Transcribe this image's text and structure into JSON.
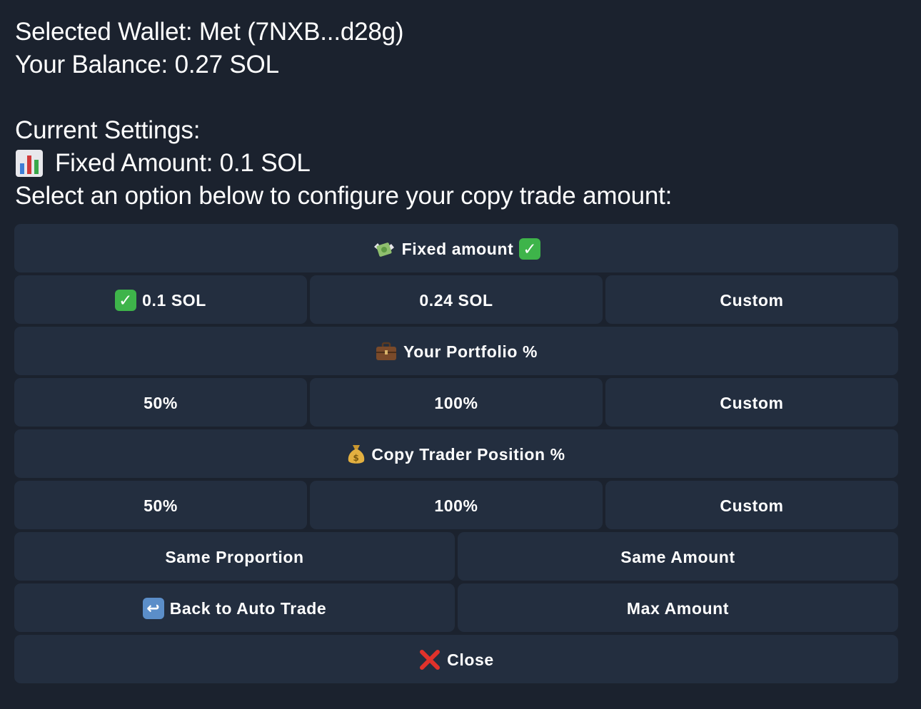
{
  "message": {
    "wallet_line": "Selected Wallet: Met (7NXB...d28g)",
    "balance_line": "Your Balance: 0.27 SOL",
    "settings_header": "Current Settings:",
    "settings_value": "Fixed Amount: 0.1 SOL",
    "instruction": "Select an option below to configure your copy trade amount:"
  },
  "keyboard": {
    "fixed_amount": "Fixed amount",
    "fixed_opt_1": "0.1 SOL",
    "fixed_opt_2": "0.24 SOL",
    "fixed_custom": "Custom",
    "portfolio": "Your Portfolio %",
    "portfolio_opt_1": "50%",
    "portfolio_opt_2": "100%",
    "portfolio_custom": "Custom",
    "trader_position": "Copy Trader Position %",
    "trader_opt_1": "50%",
    "trader_opt_2": "100%",
    "trader_custom": "Custom",
    "same_proportion": "Same Proportion",
    "same_amount": "Same Amount",
    "back": "Back to Auto Trade",
    "max_amount": "Max Amount",
    "close": "Close"
  },
  "icons": {
    "settings": "bar-chart-icon",
    "fixed_amount": "money-with-wings-icon",
    "selected": "check-mark-icon",
    "portfolio": "briefcase-icon",
    "trader_position": "money-bag-icon",
    "back": "return-arrow-icon",
    "close": "cross-mark-icon"
  },
  "colors": {
    "background": "#1b222e",
    "button": "#232e3f",
    "check": "#3eb44a",
    "close": "#e0322b"
  }
}
